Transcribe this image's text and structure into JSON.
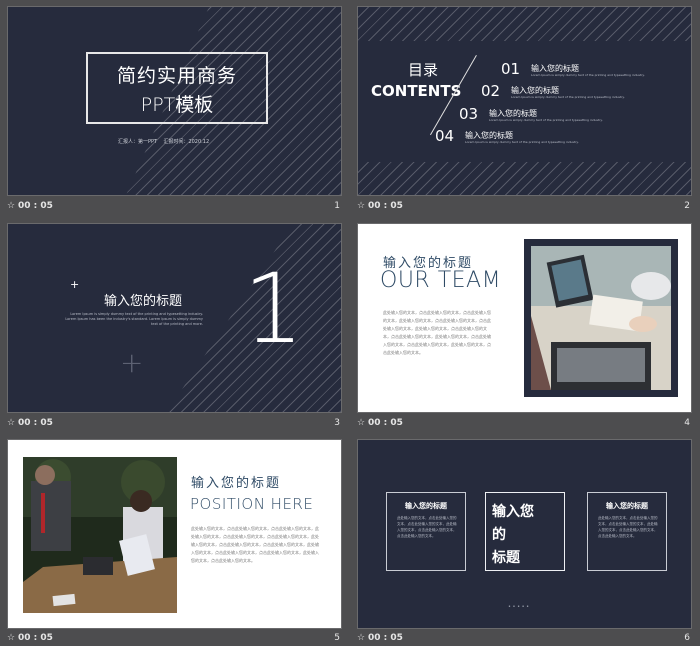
{
  "slides": [
    {
      "number": "1",
      "duration": "00 : 05",
      "title_line1": "简约实用商务",
      "title_line2": "PPT模板",
      "info": "汇报人：第一PPT    汇报时间：2020.12"
    },
    {
      "number": "2",
      "duration": "00 : 05",
      "heading_cn": "目录",
      "heading_en": "CONTENTS",
      "items": [
        {
          "num": "01",
          "title": "输入您的标题",
          "desc": "Lorem Ipsum is simply dummy text of the printing and typesetting industry."
        },
        {
          "num": "02",
          "title": "输入您的标题",
          "desc": "Lorem Ipsum is simply dummy text of the printing and typesetting industry."
        },
        {
          "num": "03",
          "title": "输入您的标题",
          "desc": "Lorem Ipsum is simply dummy text of the printing and typesetting industry."
        },
        {
          "num": "04",
          "title": "输入您的标题",
          "desc": "Lorem Ipsum is simply dummy text of the printing and typesetting industry."
        }
      ]
    },
    {
      "number": "3",
      "duration": "00 : 05",
      "title": "输入您的标题",
      "body": "Lorem Ipsum is simply dummy text of the printing and typesetting industry. Lorem Ipsum has been the industry's standard. Lorem Ipsum is simply dummy text of the printing and more.",
      "big_number": "1",
      "plus_small": "+",
      "plus_large": "+"
    },
    {
      "number": "4",
      "duration": "00 : 05",
      "title_cn": "输入您的标题",
      "title_en": "OUR TEAM",
      "body": "此处输入您的文本，点击此处输入您的文本，点击此处输入您的文本，此处输入您的文本，点击此处输入您的文本，点击此处输入您的文本，此处输入您的文本，点击此处输入您的文本，点击此处输入您的文本，此处输入您的文本，点击此处输入您的文本，点击此处输入您的文本，此处输入您的文本，点击此处输入您的文本。"
    },
    {
      "number": "5",
      "duration": "00 : 05",
      "title_cn": "输入您的标题",
      "title_en": "POSITION HERE",
      "body": "此处输入您的文本，点击此处输入您的文本，点击此处输入您的文本，此处输入您的文本，点击此处输入您的文本，点击此处输入您的文本，此处输入您的文本，点击此处输入您的文本，点击此处输入您的文本，此处输入您的文本，点击此处输入您的文本，点击此处输入您的文本，此处输入您的文本，点击此处输入您的文本。"
    },
    {
      "number": "6",
      "duration": "00 : 05",
      "left_title": "输入您的标题",
      "left_body": "此处输入您的文本，点击此处输入您的文本，点击此处输入您的文本，此处输入您的文本，点击此处输入您的文本，点击此处输入您的文本。",
      "center_line1": "输入您",
      "center_line2": "的",
      "center_line3": "标题",
      "right_title": "输入您的标题",
      "right_body": "此处输入您的文本，点击此处输入您的文本，点击此处输入您的文本，此处输入您的文本，点击此处输入您的文本，点击此处输入您的文本。",
      "dots": "• • • • •"
    }
  ],
  "colors": {
    "navy": "#262b3d",
    "teal": "#2f4b66",
    "white": "#ffffff",
    "background": "#4d4d4f"
  },
  "icons": {
    "timer": "slide-timer-icon"
  }
}
